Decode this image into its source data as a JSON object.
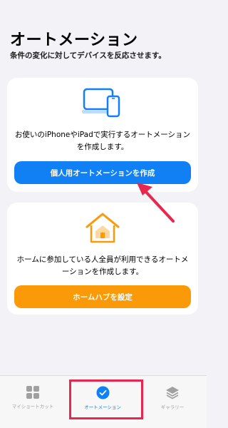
{
  "header": {
    "title": "オートメーション",
    "subtitle": "条件の変化に対してデバイスを反応させます。"
  },
  "personal_card": {
    "icon": "devices-icon",
    "description": "お使いのiPhoneやiPadで実行するオートメーションを作成します。",
    "button_label": "個人用オートメーションを作成"
  },
  "home_card": {
    "icon": "home-icon",
    "description": "ホームに参加している人全員が利用できるオートメーションを作成します。",
    "button_label": "ホームハブを設定"
  },
  "tabbar": {
    "tabs": [
      {
        "label": "マイショートカット",
        "icon": "grid-icon",
        "selected": false
      },
      {
        "label": "オートメーション",
        "icon": "checkmark-clock-icon",
        "selected": true
      },
      {
        "label": "ギャラリー",
        "icon": "layers-icon",
        "selected": false
      }
    ]
  },
  "colors": {
    "accent_blue": "#1180f5",
    "accent_orange": "#fb9a09",
    "annotation_red": "#e8264e",
    "background": "#f2f2f7"
  }
}
